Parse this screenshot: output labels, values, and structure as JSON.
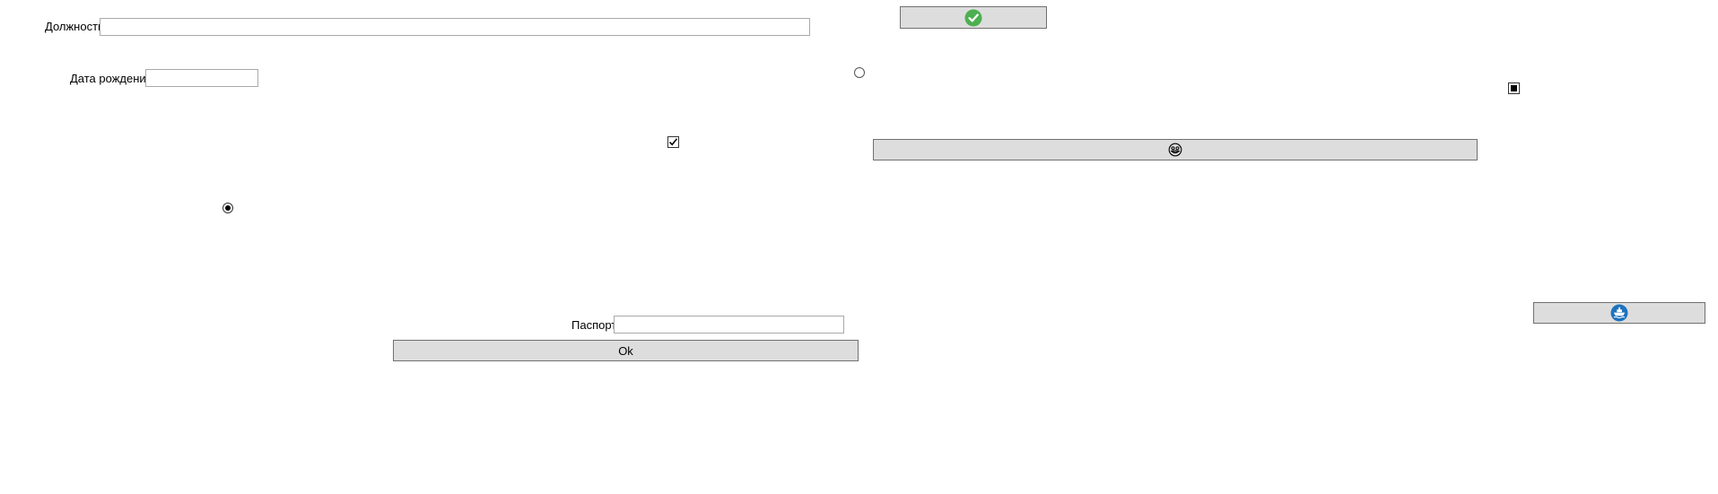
{
  "form": {
    "position_label": "Должность",
    "position_value": "",
    "birthdate_label": "Дата рождения",
    "birthdate_value": "",
    "passport_label": "Паспорт",
    "passport_value": "",
    "ok_button_label": "Ok"
  },
  "controls": {
    "checkbox_checked": true,
    "checkbox_indeterminate": true,
    "radio_1_checked": true,
    "radio_2_checked": false
  },
  "icons": {
    "confirm_button_icon": "check-circle-icon",
    "face_button_icon": "smiley-face-icon",
    "ship_button_icon": "ship-icon",
    "confirm_color": "#4caf50",
    "ship_color": "#1e73be"
  }
}
